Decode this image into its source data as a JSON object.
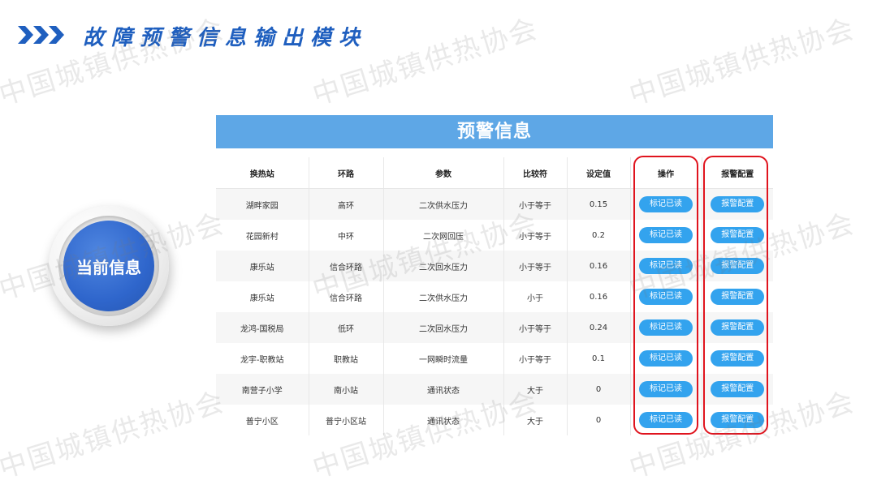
{
  "header": {
    "title": "故障预警信息输出模块",
    "chevron_icon": "triple-chevron-right",
    "accent": "#1f5fbf"
  },
  "badge": {
    "label": "当前信息",
    "color": "#2f66cc"
  },
  "watermark": "中国城镇供热协会",
  "panel": {
    "title": "预警信息",
    "title_bg": "#5ea7e6",
    "columns": [
      "换热站",
      "环路",
      "参数",
      "比较符",
      "设定值",
      "操作",
      "报警配置"
    ],
    "rows": [
      {
        "station": "湖畔家园",
        "loop": "高环",
        "param": "二次供水压力",
        "cmp": "小于等于",
        "value": "0.15",
        "action": "标记已读",
        "config": "报警配置"
      },
      {
        "station": "花园新村",
        "loop": "中环",
        "param": "二次网回压",
        "cmp": "小于等于",
        "value": "0.2",
        "action": "标记已读",
        "config": "报警配置"
      },
      {
        "station": "康乐站",
        "loop": "信合环路",
        "param": "二次回水压力",
        "cmp": "小于等于",
        "value": "0.16",
        "action": "标记已读",
        "config": "报警配置"
      },
      {
        "station": "康乐站",
        "loop": "信合环路",
        "param": "二次供水压力",
        "cmp": "小于",
        "value": "0.16",
        "action": "标记已读",
        "config": "报警配置"
      },
      {
        "station": "龙鸿-国税局",
        "loop": "低环",
        "param": "二次回水压力",
        "cmp": "小于等于",
        "value": "0.24",
        "action": "标记已读",
        "config": "报警配置"
      },
      {
        "station": "龙宇-职教站",
        "loop": "职教站",
        "param": "一网瞬时流量",
        "cmp": "小于等于",
        "value": "0.1",
        "action": "标记已读",
        "config": "报警配置"
      },
      {
        "station": "南营子小学",
        "loop": "南小站",
        "param": "通讯状态",
        "cmp": "大于",
        "value": "0",
        "action": "标记已读",
        "config": "报警配置"
      },
      {
        "station": "普宁小区",
        "loop": "普宁小区站",
        "param": "通讯状态",
        "cmp": "大于",
        "value": "0",
        "action": "标记已读",
        "config": "报警配置"
      }
    ],
    "button_color": "#33a3ee",
    "highlight_color": "#e0141e"
  }
}
